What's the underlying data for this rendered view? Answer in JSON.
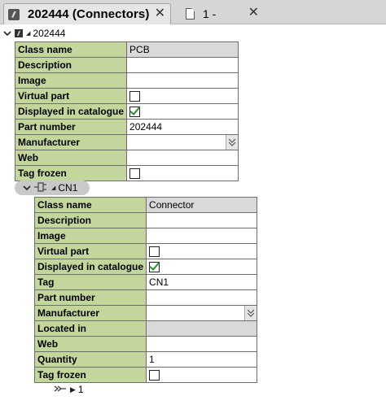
{
  "tabs": [
    {
      "title": "202444 (Connectors)",
      "icon": "part-doc-icon",
      "close": "✕"
    },
    {
      "title": "1 -",
      "icon": "page-icon",
      "close": "✕"
    }
  ],
  "tree": {
    "root_label": "202444",
    "child_label": "CN1",
    "grandchild_label": "1"
  },
  "table1": [
    {
      "label": "Class name",
      "type": "text",
      "value": "PCB",
      "style": "gray"
    },
    {
      "label": "Description",
      "type": "text",
      "value": ""
    },
    {
      "label": "Image",
      "type": "text",
      "value": ""
    },
    {
      "label": "Virtual part",
      "type": "checkbox",
      "checked": false
    },
    {
      "label": "Displayed in catalogue",
      "type": "checkbox",
      "checked": true
    },
    {
      "label": "Part number",
      "type": "text",
      "value": "202444"
    },
    {
      "label": "Manufacturer",
      "type": "dropdown",
      "value": ""
    },
    {
      "label": "Web",
      "type": "text",
      "value": ""
    },
    {
      "label": "Tag frozen",
      "type": "checkbox",
      "checked": false
    }
  ],
  "table2": [
    {
      "label": "Class name",
      "type": "text",
      "value": "Connector",
      "style": "gray"
    },
    {
      "label": "Description",
      "type": "text",
      "value": ""
    },
    {
      "label": "Image",
      "type": "text",
      "value": ""
    },
    {
      "label": "Virtual part",
      "type": "checkbox",
      "checked": false
    },
    {
      "label": "Displayed in catalogue",
      "type": "checkbox",
      "checked": true
    },
    {
      "label": "Tag",
      "type": "text",
      "value": "CN1"
    },
    {
      "label": "Part number",
      "type": "text",
      "value": ""
    },
    {
      "label": "Manufacturer",
      "type": "dropdown",
      "value": ""
    },
    {
      "label": "Located in",
      "type": "text",
      "value": "",
      "style": "gray"
    },
    {
      "label": "Web",
      "type": "text",
      "value": ""
    },
    {
      "label": "Quantity",
      "type": "text",
      "value": "1"
    },
    {
      "label": "Tag frozen",
      "type": "checkbox",
      "checked": false
    }
  ],
  "colors": {
    "label_bg": "#c3d69b",
    "readonly_bg": "#d9d9d9",
    "check_color": "#2e8b3a"
  }
}
